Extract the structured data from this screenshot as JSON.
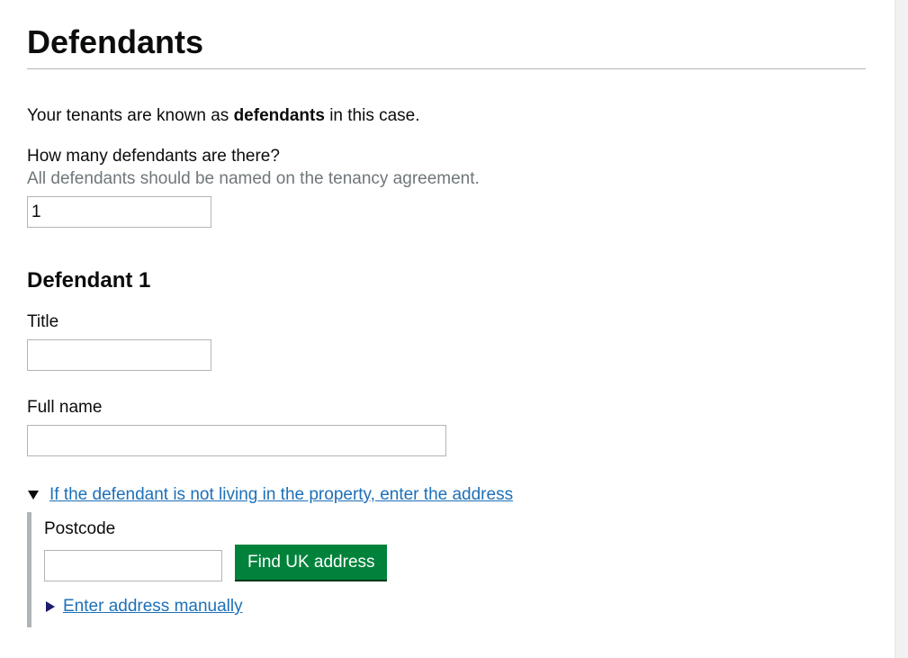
{
  "page": {
    "title": "Defendants",
    "intro_before": "Your tenants are known as ",
    "intro_bold": "defendants",
    "intro_after": " in this case."
  },
  "defendant_count": {
    "label": "How many defendants are there?",
    "hint": "All defendants should be named on the tenancy agreement.",
    "value": "1"
  },
  "defendant_1": {
    "heading": "Defendant 1",
    "title_label": "Title",
    "title_value": "",
    "full_name_label": "Full name",
    "full_name_value": ""
  },
  "address_details": {
    "summary": "If the defendant is not living in the property, enter the address",
    "expanded": true,
    "postcode_label": "Postcode",
    "postcode_value": "",
    "find_button": "Find UK address",
    "manual_link": "Enter address manually"
  },
  "colors": {
    "link": "#1d70b8",
    "button": "#00823b",
    "hint": "#6f777b",
    "border": "#b1b4b6"
  }
}
